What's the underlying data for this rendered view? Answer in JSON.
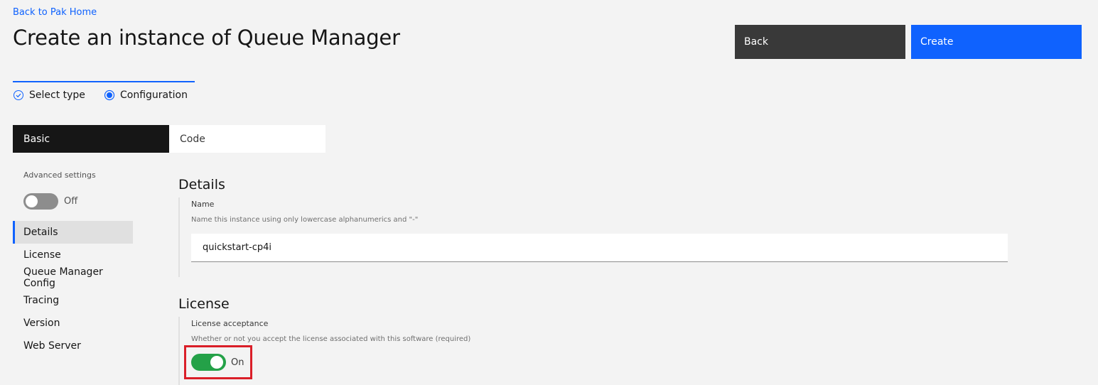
{
  "header": {
    "back_link": "Back to Pak Home",
    "title": "Create an instance of Queue Manager",
    "back_button": "Back",
    "create_button": "Create"
  },
  "progress": {
    "steps": [
      {
        "label": "Select type",
        "state": "complete",
        "icon": "checkmark-outline-icon"
      },
      {
        "label": "Configuration",
        "state": "current",
        "icon": "radio-button-checked-icon"
      }
    ]
  },
  "tabs": [
    {
      "label": "Basic",
      "selected": true
    },
    {
      "label": "Code",
      "selected": false
    }
  ],
  "sidebar": {
    "advanced_label": "Advanced settings",
    "advanced_toggle_state": "Off",
    "items": [
      {
        "label": "Details",
        "active": true
      },
      {
        "label": "License",
        "active": false
      },
      {
        "label": "Queue Manager Config",
        "active": false
      },
      {
        "label": "Tracing",
        "active": false
      },
      {
        "label": "Version",
        "active": false
      },
      {
        "label": "Web Server",
        "active": false
      }
    ]
  },
  "details": {
    "title": "Details",
    "name_label": "Name",
    "name_help": "Name this instance using only lowercase alphanumerics and \"-\"",
    "name_value": "quickstart-cp4i"
  },
  "license": {
    "title": "License",
    "acceptance_label": "License acceptance",
    "acceptance_help": "Whether or not you accept the license associated with this software (required)",
    "toggle_state": "On"
  },
  "colors": {
    "accent": "#0f62fe",
    "toggle_on": "#24a148",
    "highlight": "#da1e28",
    "dark_button": "#393939"
  }
}
